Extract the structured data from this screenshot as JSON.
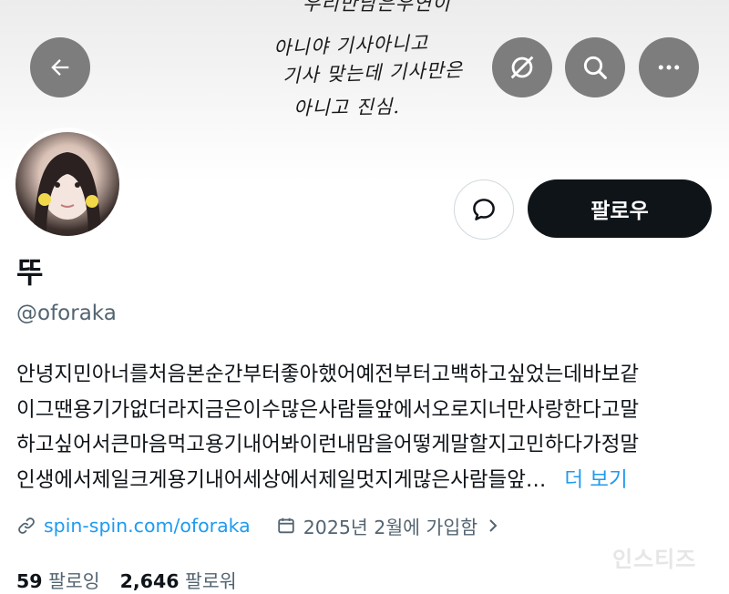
{
  "banner": {
    "handwriting": [
      "우리만남은우연이",
      "아니야 기사아니고",
      "기사 맞는데 기사만은",
      "아니고 진심."
    ]
  },
  "header": {
    "back_icon": "arrow-left-icon",
    "mute_icon": "mute-icon",
    "search_icon": "search-icon",
    "more_icon": "more-horizontal-icon"
  },
  "profile": {
    "display_name": "뚜",
    "handle": "@oforaka",
    "follow_label": "팔로우",
    "message_icon": "message-bubble-icon",
    "bio_lines": [
      "안녕지민아너를처음본순간부터좋아했어예전부터고백하고싶었는데바보같",
      "이그땐용기가없더라지금은이수많은사람들앞에서오로지너만사랑한다고말",
      "하고싶어서큰마음먹고용기내어봐이런내맘을어떻게말할지고민하다가정말",
      "인생에서제일크게용기내어세상에서제일멋지게많은사람들앞…"
    ],
    "more_label": "더 보기",
    "link": "spin-spin.com/oforaka",
    "joined": "2025년 2월에 가입함",
    "following_count": "59",
    "following_label": "팔로잉",
    "followers_count": "2,646",
    "followers_label": "팔로워"
  },
  "watermark": "인스티즈",
  "colors": {
    "accent": "#1d9bf0",
    "text": "#0f1419",
    "secondary": "#536471",
    "overlay_button": "#7d7d7d"
  }
}
